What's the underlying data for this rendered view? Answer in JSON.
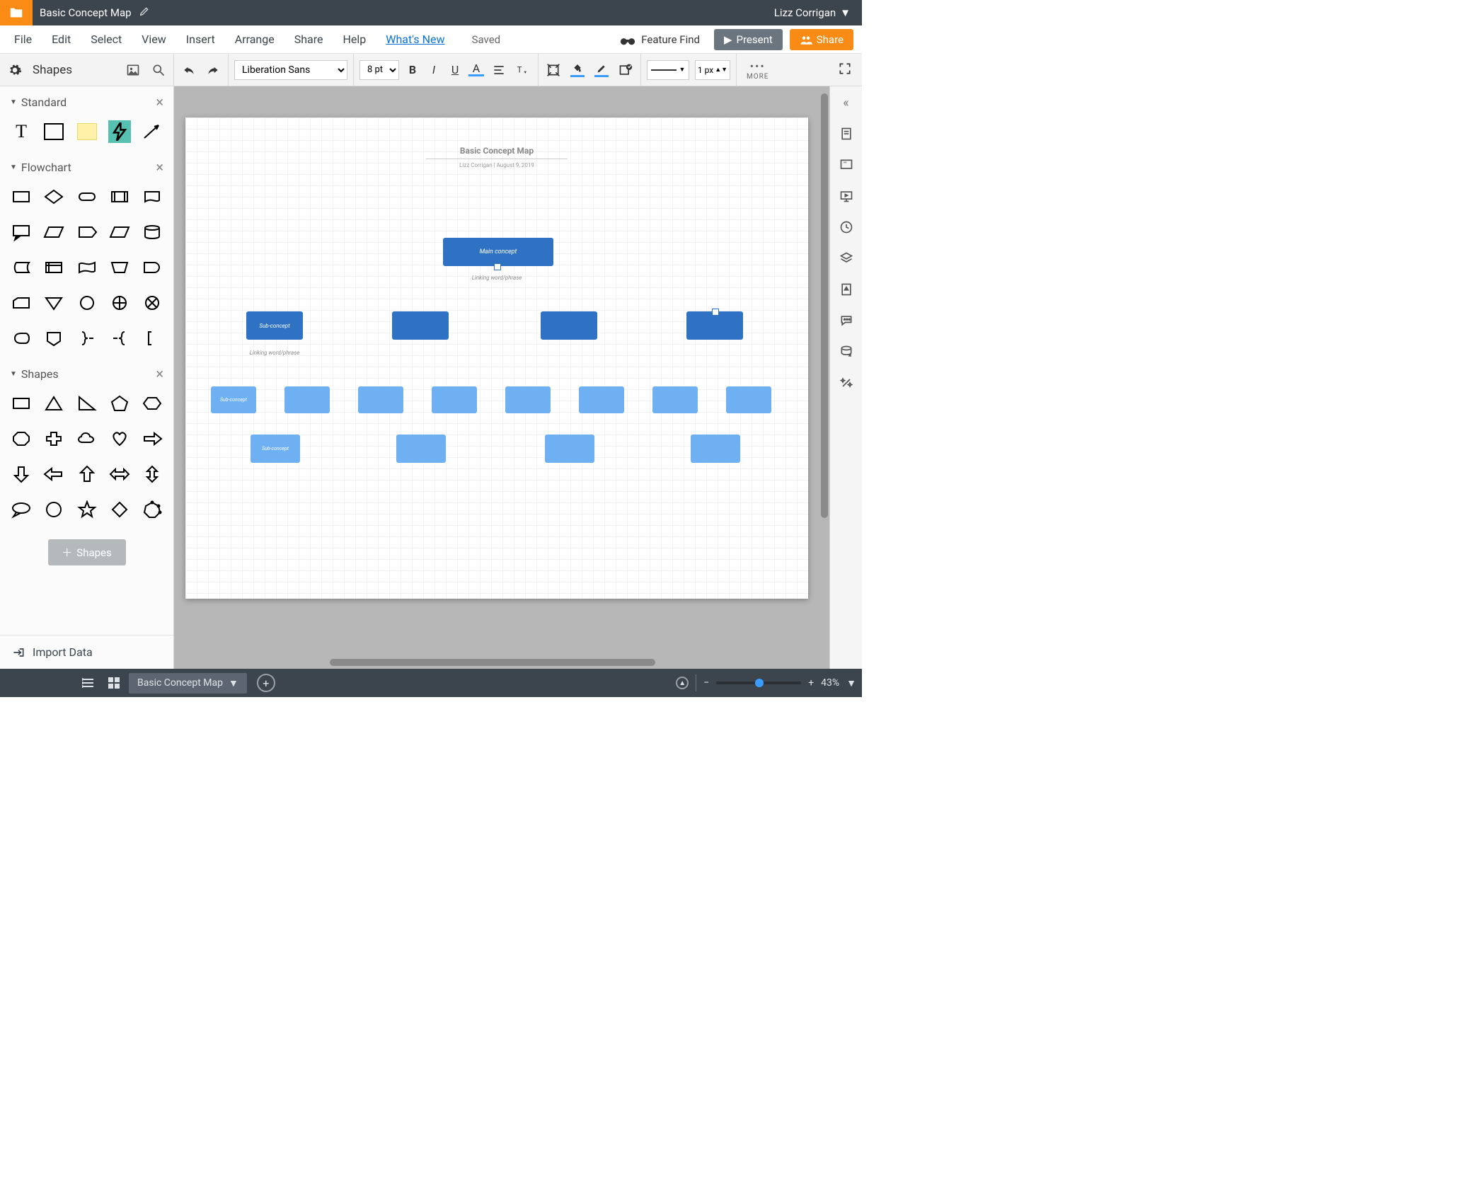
{
  "title": "Basic Concept Map",
  "user": "Lizz Corrigan",
  "menu": {
    "file": "File",
    "edit": "Edit",
    "select": "Select",
    "view": "View",
    "insert": "Insert",
    "arrange": "Arrange",
    "share": "Share",
    "help": "Help",
    "whatsnew": "What's New",
    "saved": "Saved",
    "feature_find": "Feature Find",
    "present": "Present",
    "share_btn": "Share"
  },
  "toolbar": {
    "shapes_label": "Shapes",
    "font": "Liberation Sans",
    "font_size": "8 pt",
    "line_width": "1 px",
    "more": "MORE"
  },
  "left_panel": {
    "sections": {
      "standard": "Standard",
      "flowchart": "Flowchart",
      "shapes": "Shapes"
    },
    "add_shapes": "Shapes",
    "import_data": "Import Data"
  },
  "canvas": {
    "doc_title": "Basic Concept Map",
    "byline": "Lizz Corrigan  |  August 9, 2019",
    "main_concept": "Main concept",
    "linking": "Linking word/phrase",
    "sub_concept": "Sub-concept"
  },
  "bottom": {
    "tab": "Basic Concept Map",
    "zoom": "43%"
  }
}
